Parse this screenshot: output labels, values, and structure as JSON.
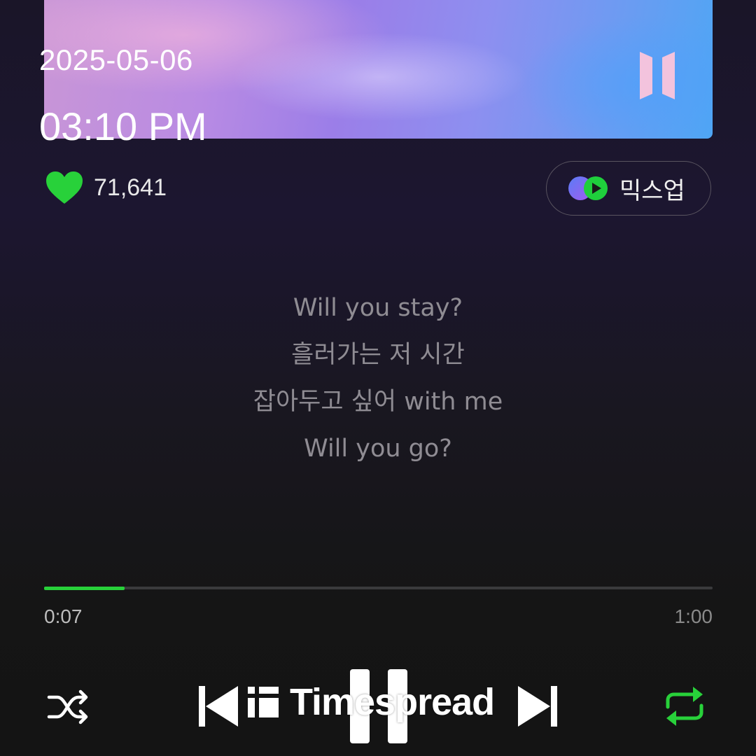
{
  "status": {
    "date": "2025-05-06",
    "time": "03:10 PM"
  },
  "album": {
    "logo_icon": "bts-logo-icon"
  },
  "likes": {
    "icon": "heart-icon",
    "count": "71,641",
    "color": "#28d13a"
  },
  "mixup": {
    "label": "믹스업",
    "icon": "mixup-icon"
  },
  "lyrics": [
    "Will you stay?",
    "흘러가는 저 시간",
    "잡아두고 싶어 with me",
    "Will you go?"
  ],
  "player": {
    "elapsed": "0:07",
    "duration": "1:00",
    "progress_fraction": 0.12,
    "accent": "#28d13a"
  },
  "controls": {
    "shuffle_icon": "shuffle-icon",
    "prev_icon": "skip-previous-icon",
    "pause_icon": "pause-icon",
    "next_icon": "skip-next-icon",
    "repeat_icon": "repeat-icon"
  },
  "watermark": {
    "text": "Timespread"
  }
}
